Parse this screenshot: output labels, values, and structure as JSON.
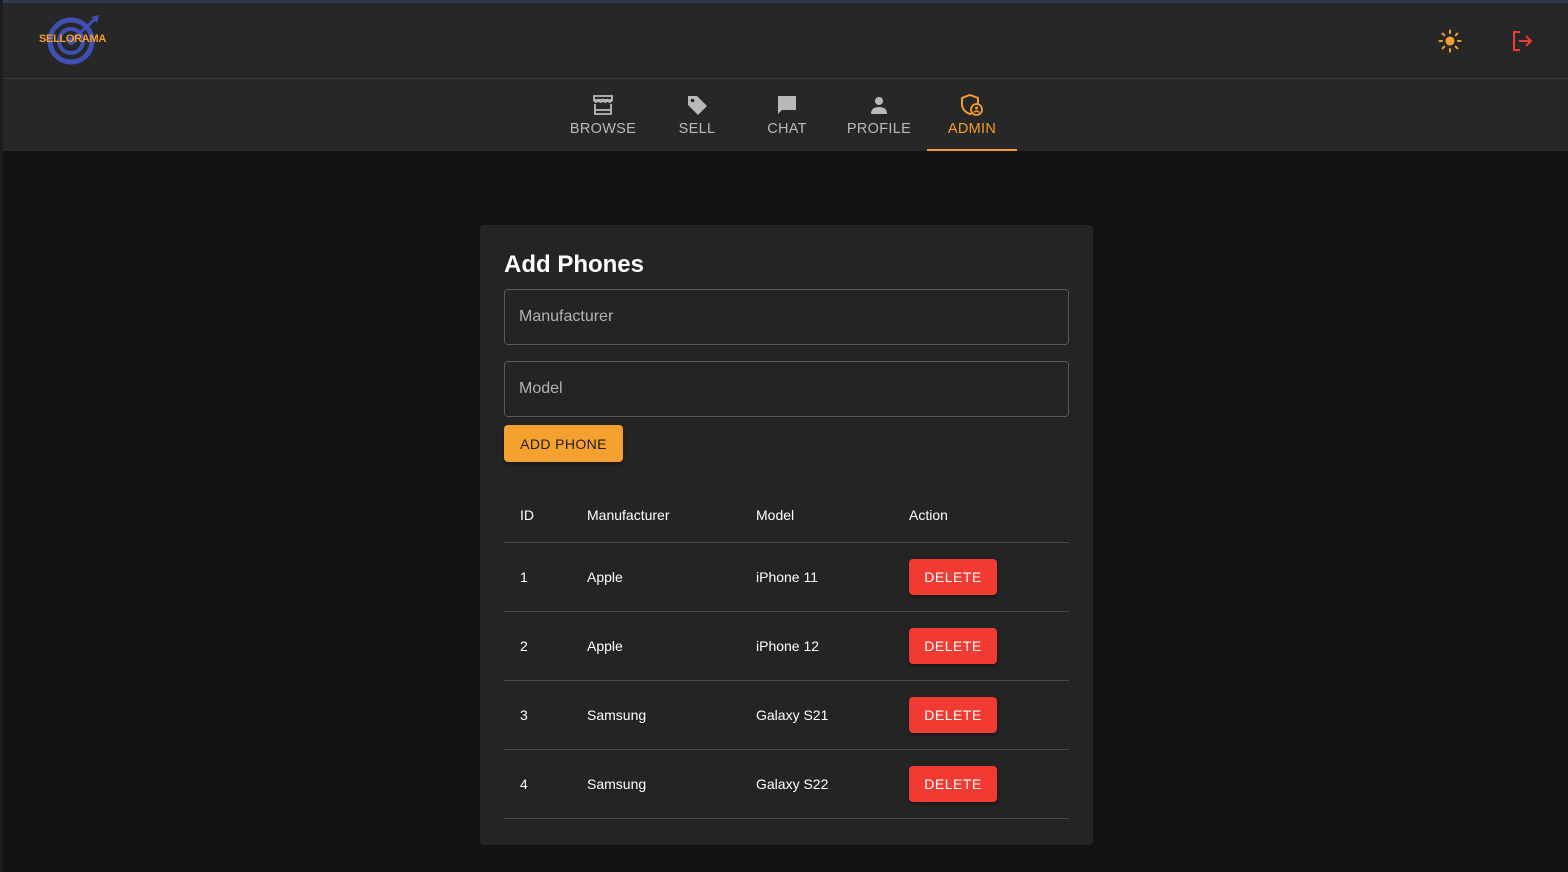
{
  "app": {
    "logo_text": "SELLORAMA"
  },
  "header": {
    "theme_toggle_icon": "sun-icon",
    "logout_icon": "logout-icon"
  },
  "nav": {
    "tabs": [
      {
        "label": "BROWSE",
        "icon": "storefront-icon",
        "active": false
      },
      {
        "label": "SELL",
        "icon": "tag-icon",
        "active": false
      },
      {
        "label": "CHAT",
        "icon": "chat-icon",
        "active": false
      },
      {
        "label": "PROFILE",
        "icon": "person-icon",
        "active": false
      },
      {
        "label": "ADMIN",
        "icon": "admin-shield-icon",
        "active": true
      }
    ]
  },
  "form": {
    "title": "Add Phones",
    "manufacturer_placeholder": "Manufacturer",
    "manufacturer_value": "",
    "model_placeholder": "Model",
    "model_value": "",
    "add_button_label": "ADD PHONE"
  },
  "table": {
    "headers": [
      "ID",
      "Manufacturer",
      "Model",
      "Action"
    ],
    "rows": [
      {
        "id": "1",
        "manufacturer": "Apple",
        "model": "iPhone 11",
        "action": "DELETE"
      },
      {
        "id": "2",
        "manufacturer": "Apple",
        "model": "iPhone 12",
        "action": "DELETE"
      },
      {
        "id": "3",
        "manufacturer": "Samsung",
        "model": "Galaxy S21",
        "action": "DELETE"
      },
      {
        "id": "4",
        "manufacturer": "Samsung",
        "model": "Galaxy S22",
        "action": "DELETE"
      }
    ]
  },
  "colors": {
    "accent": "#f39c2d",
    "danger": "#f03a32",
    "surface": "#242424",
    "background": "#121212"
  }
}
